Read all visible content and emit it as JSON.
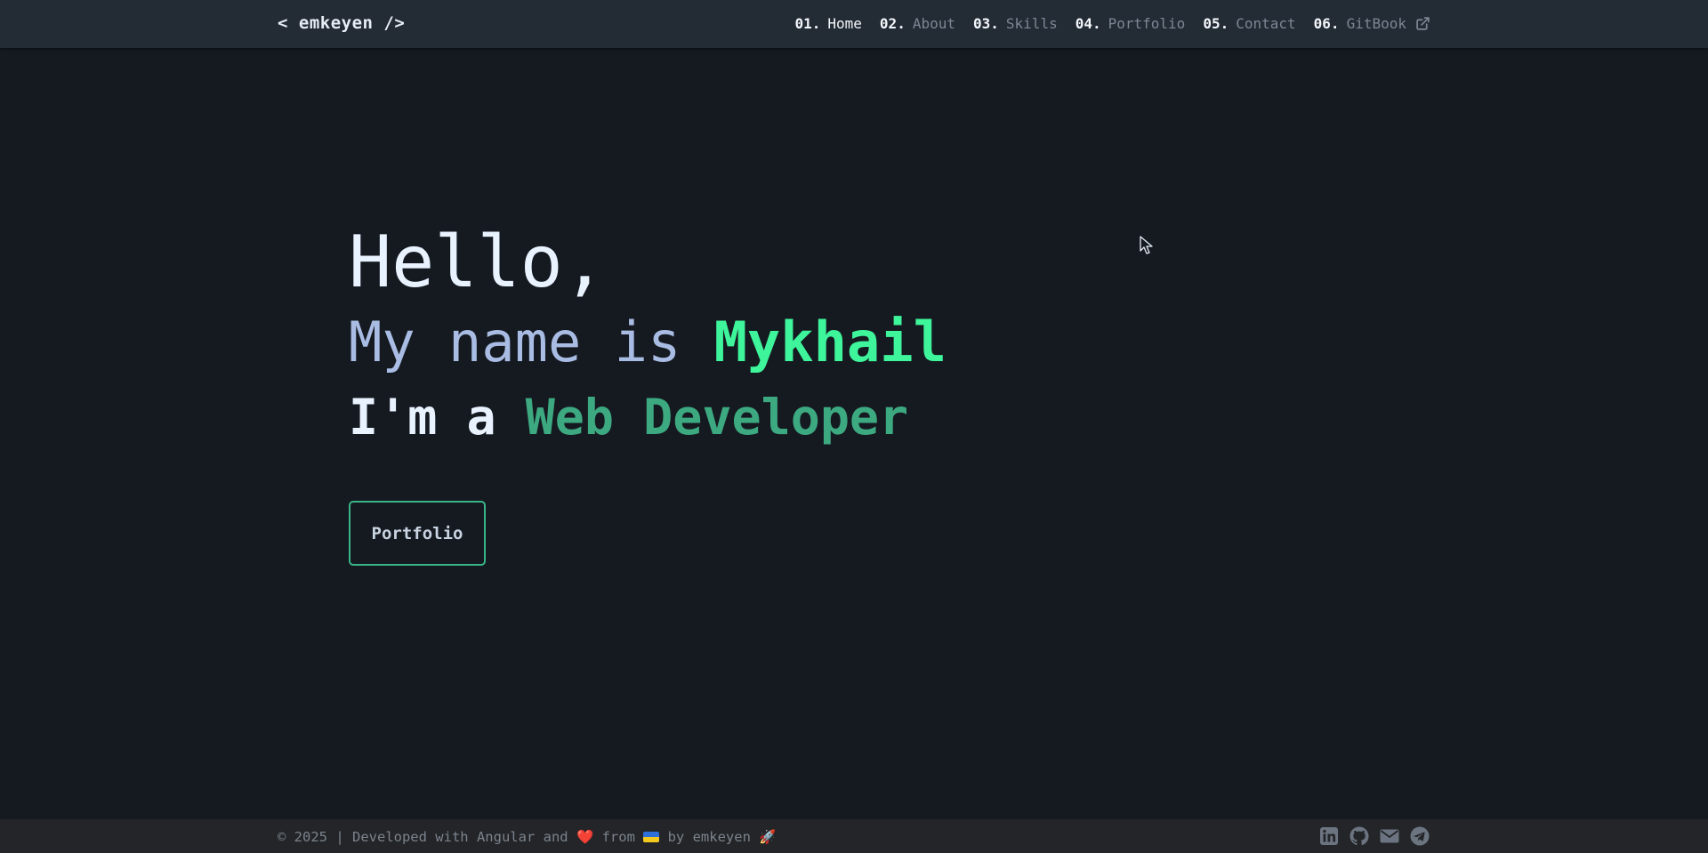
{
  "brand": "< emkeyen />",
  "nav": [
    {
      "num": "01.",
      "label": "Home"
    },
    {
      "num": "02.",
      "label": "About"
    },
    {
      "num": "03.",
      "label": "Skills"
    },
    {
      "num": "04.",
      "label": "Portfolio"
    },
    {
      "num": "05.",
      "label": "Contact"
    },
    {
      "num": "06.",
      "label": "GitBook",
      "icon": "external-link-icon"
    }
  ],
  "hero": {
    "greeting": "Hello,",
    "name_prefix": "My name is ",
    "name": "Mykhail",
    "role_prefix": "I'm a ",
    "role": "Web Developer",
    "button": "Portfolio"
  },
  "footer": {
    "text_before_heart": "© 2025 | Developed with Angular and ",
    "heart": "❤️",
    "text_from": " from ",
    "text_after_flag": " by emkeyen ",
    "rocket": "🚀",
    "social_icons": [
      "linkedin-icon",
      "github-icon",
      "email-icon",
      "telegram-icon"
    ]
  },
  "colors": {
    "background": "#151a21",
    "navbar": "#232b35",
    "accent": "#3ef59b",
    "role_accent": "#3da981",
    "button_border": "#38b487"
  }
}
